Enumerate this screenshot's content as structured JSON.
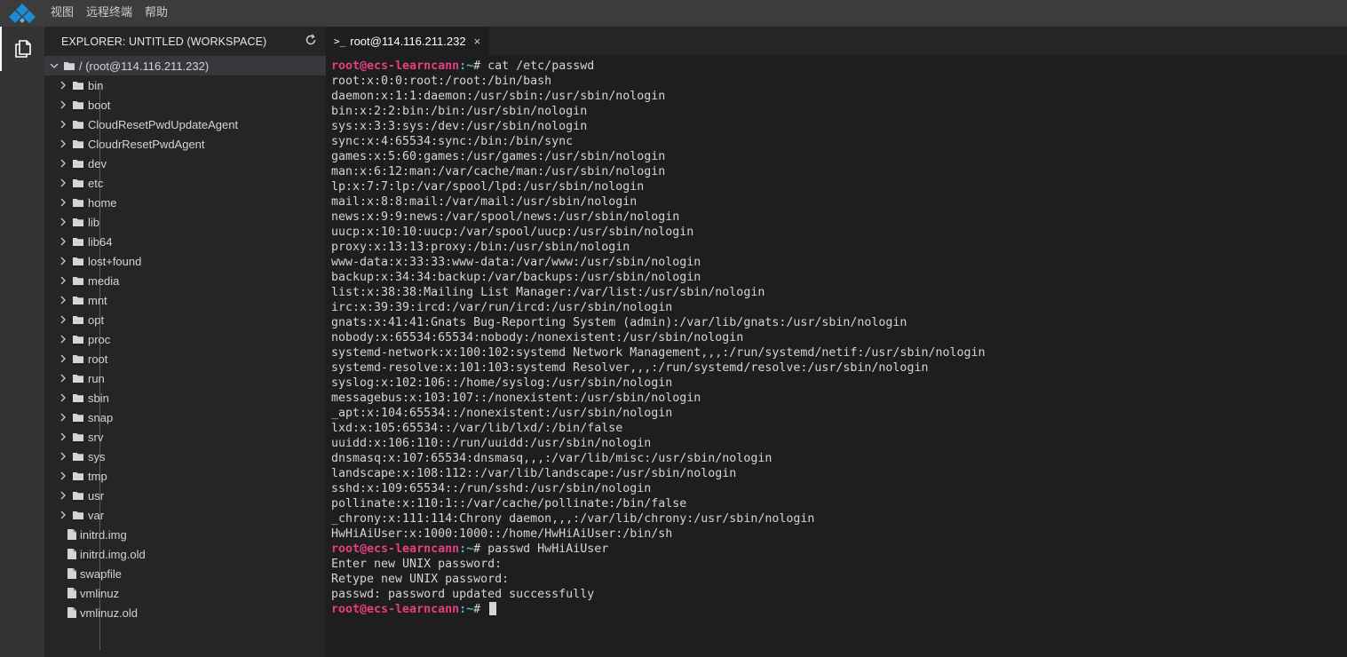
{
  "menu": {
    "items": [
      "视图",
      "远程终端",
      "帮助"
    ]
  },
  "colors": {
    "accent": "#1e8bd6",
    "prompt_user": "#e83d80",
    "prompt_path": "#4fb3d9"
  },
  "explorer": {
    "title": "EXPLORER: UNTITLED (WORKSPACE)",
    "refresh_icon": "refresh-icon",
    "root": "/ (root@114.116.211.232)",
    "folders": [
      "bin",
      "boot",
      "CloudResetPwdUpdateAgent",
      "CloudrResetPwdAgent",
      "dev",
      "etc",
      "home",
      "lib",
      "lib64",
      "lost+found",
      "media",
      "mnt",
      "opt",
      "proc",
      "root",
      "run",
      "sbin",
      "snap",
      "srv",
      "sys",
      "tmp",
      "usr",
      "var"
    ],
    "files": [
      "initrd.img",
      "initrd.img.old",
      "swapfile",
      "vmlinuz",
      "vmlinuz.old"
    ]
  },
  "tab": {
    "prompt": ">_",
    "label": "root@114.116.211.232",
    "close": "×"
  },
  "terminal": {
    "prompt_user": "root@ecs-learncann",
    "prompt_path": ":~",
    "prompt_symbol": "# ",
    "lines": [
      {
        "prompt": true,
        "text": "cat /etc/passwd"
      },
      {
        "text": "root:x:0:0:root:/root:/bin/bash"
      },
      {
        "text": "daemon:x:1:1:daemon:/usr/sbin:/usr/sbin/nologin"
      },
      {
        "text": "bin:x:2:2:bin:/bin:/usr/sbin/nologin"
      },
      {
        "text": "sys:x:3:3:sys:/dev:/usr/sbin/nologin"
      },
      {
        "text": "sync:x:4:65534:sync:/bin:/bin/sync"
      },
      {
        "text": "games:x:5:60:games:/usr/games:/usr/sbin/nologin"
      },
      {
        "text": "man:x:6:12:man:/var/cache/man:/usr/sbin/nologin"
      },
      {
        "text": "lp:x:7:7:lp:/var/spool/lpd:/usr/sbin/nologin"
      },
      {
        "text": "mail:x:8:8:mail:/var/mail:/usr/sbin/nologin"
      },
      {
        "text": "news:x:9:9:news:/var/spool/news:/usr/sbin/nologin"
      },
      {
        "text": "uucp:x:10:10:uucp:/var/spool/uucp:/usr/sbin/nologin"
      },
      {
        "text": "proxy:x:13:13:proxy:/bin:/usr/sbin/nologin"
      },
      {
        "text": "www-data:x:33:33:www-data:/var/www:/usr/sbin/nologin"
      },
      {
        "text": "backup:x:34:34:backup:/var/backups:/usr/sbin/nologin"
      },
      {
        "text": "list:x:38:38:Mailing List Manager:/var/list:/usr/sbin/nologin"
      },
      {
        "text": "irc:x:39:39:ircd:/var/run/ircd:/usr/sbin/nologin"
      },
      {
        "text": "gnats:x:41:41:Gnats Bug-Reporting System (admin):/var/lib/gnats:/usr/sbin/nologin"
      },
      {
        "text": "nobody:x:65534:65534:nobody:/nonexistent:/usr/sbin/nologin"
      },
      {
        "text": "systemd-network:x:100:102:systemd Network Management,,,:/run/systemd/netif:/usr/sbin/nologin"
      },
      {
        "text": "systemd-resolve:x:101:103:systemd Resolver,,,:/run/systemd/resolve:/usr/sbin/nologin"
      },
      {
        "text": "syslog:x:102:106::/home/syslog:/usr/sbin/nologin"
      },
      {
        "text": "messagebus:x:103:107::/nonexistent:/usr/sbin/nologin"
      },
      {
        "text": "_apt:x:104:65534::/nonexistent:/usr/sbin/nologin"
      },
      {
        "text": "lxd:x:105:65534::/var/lib/lxd/:/bin/false"
      },
      {
        "text": "uuidd:x:106:110::/run/uuidd:/usr/sbin/nologin"
      },
      {
        "text": "dnsmasq:x:107:65534:dnsmasq,,,:/var/lib/misc:/usr/sbin/nologin"
      },
      {
        "text": "landscape:x:108:112::/var/lib/landscape:/usr/sbin/nologin"
      },
      {
        "text": "sshd:x:109:65534::/run/sshd:/usr/sbin/nologin"
      },
      {
        "text": "pollinate:x:110:1::/var/cache/pollinate:/bin/false"
      },
      {
        "text": "_chrony:x:111:114:Chrony daemon,,,:/var/lib/chrony:/usr/sbin/nologin"
      },
      {
        "text": "HwHiAiUser:x:1000:1000::/home/HwHiAiUser:/bin/sh"
      },
      {
        "prompt": true,
        "text": "passwd HwHiAiUser"
      },
      {
        "text": "Enter new UNIX password:"
      },
      {
        "text": "Retype new UNIX password:"
      },
      {
        "text": "passwd: password updated successfully"
      },
      {
        "prompt": true,
        "text": "",
        "cursor": true
      }
    ]
  }
}
